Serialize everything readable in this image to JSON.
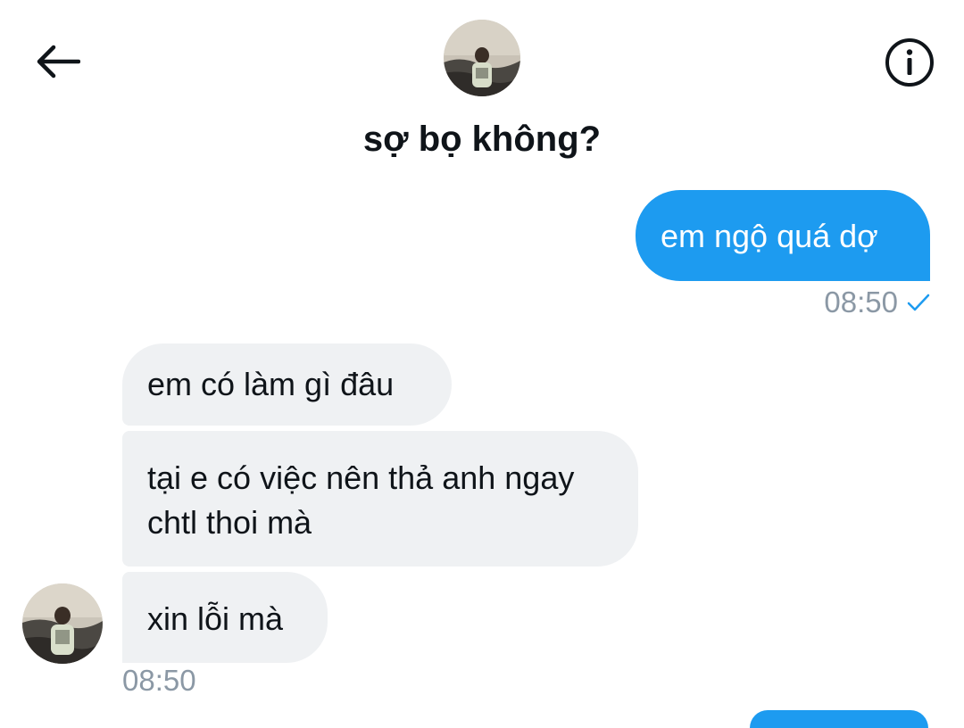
{
  "header": {
    "title": "sợ bọ không?",
    "back_icon": "arrow-left-icon",
    "info_icon": "info-circle-icon"
  },
  "messages": {
    "outgoing": [
      {
        "text": "em ngộ quá dợ",
        "time": "08:50",
        "status": "sent-check"
      }
    ],
    "incoming": [
      {
        "text": "em có làm gì đâu"
      },
      {
        "text": "tại e có việc nên thả anh ngay chtl thoi mà"
      },
      {
        "text": "xin lỗi mà"
      }
    ],
    "incoming_time": "08:50"
  },
  "colors": {
    "outgoing_bubble": "#1d9bf0",
    "incoming_bubble": "#eff1f3",
    "timestamp": "#8b98a5",
    "text": "#0f1419"
  }
}
